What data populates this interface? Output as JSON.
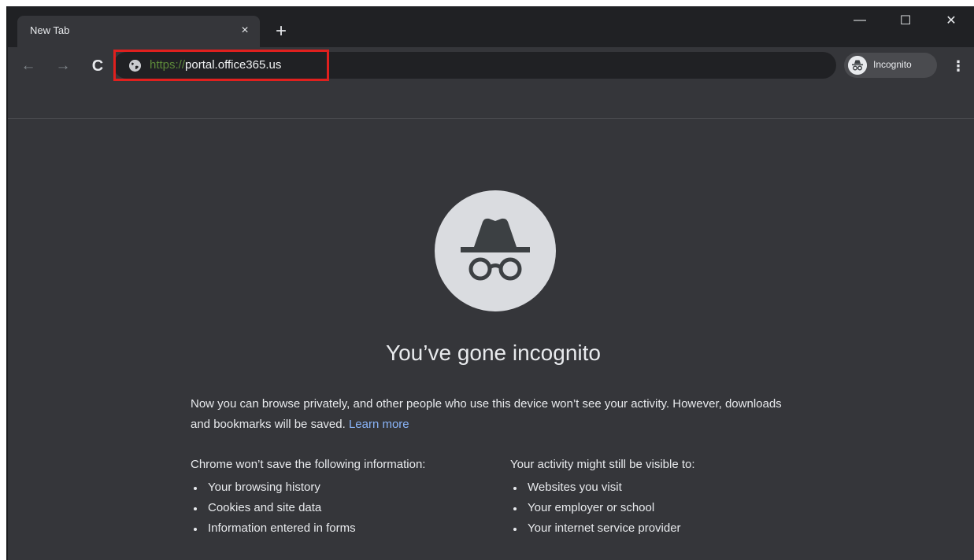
{
  "colors": {
    "frame": "#202124",
    "toolbar": "#35363a",
    "omnibox": "#202124",
    "highlight_box": "#e0201e",
    "link": "#8ab4f8",
    "url_scheme": "#5d8a3a"
  },
  "tab": {
    "title": "New Tab",
    "close_icon": "×"
  },
  "new_tab_icon": "+",
  "window_controls": {
    "minimize": "—",
    "maximize": "☐",
    "close": "✕"
  },
  "toolbar": {
    "back_icon": "←",
    "forward_icon": "→",
    "reload_icon": "C",
    "url_scheme": "https://",
    "url_host": "portal.office365.us",
    "profile_label": "Incognito",
    "menu_icon": "⋮"
  },
  "page": {
    "headline": "You’ve gone incognito",
    "intro_text": "Now you can browse privately, and other people who use this device won’t see your activity. However, downloads and bookmarks will be saved.",
    "learn_more": "Learn more",
    "left_heading": "Chrome won’t save the following information:",
    "left_items": [
      "Your browsing history",
      "Cookies and site data",
      "Information entered in forms"
    ],
    "right_heading": "Your activity might still be visible to:",
    "right_items": [
      "Websites you visit",
      "Your employer or school",
      "Your internet service provider"
    ]
  }
}
